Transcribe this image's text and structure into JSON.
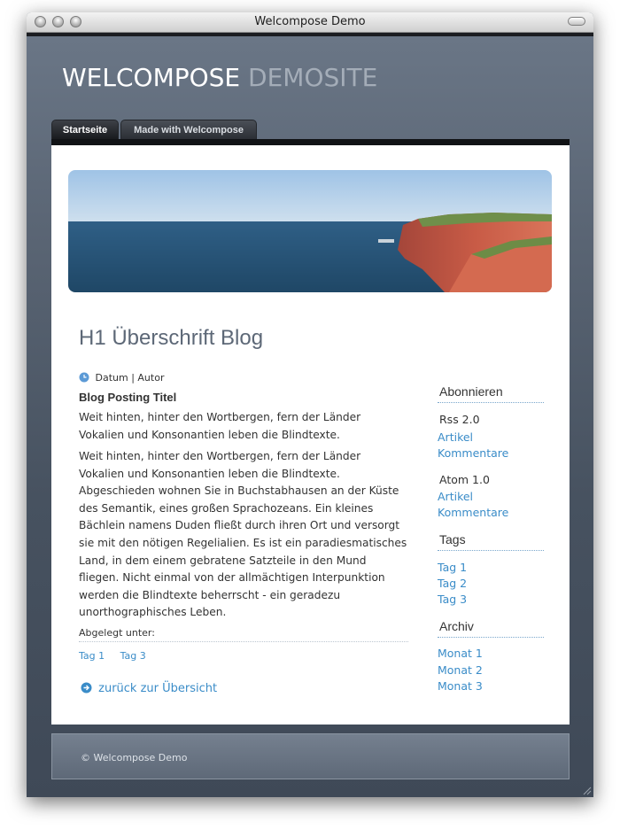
{
  "window": {
    "title": "Welcompose Demo"
  },
  "site": {
    "title_main": "WELCOMPOSE",
    "title_accent": "DEMOSITE"
  },
  "nav": {
    "tabs": [
      {
        "label": "Startseite"
      },
      {
        "label": "Made with Welcompose"
      }
    ]
  },
  "main": {
    "heading": "H1 Überschrift Blog",
    "meta": "Datum | Autor",
    "post_title": "Blog Posting Titel",
    "paragraph1": "Weit hinten, hinter den Wortbergen, fern der Länder Vokalien und Konsonantien leben die Blindtexte.",
    "paragraph2": "Weit hinten, hinter den Wortbergen, fern der Länder Vokalien und Konsonantien leben die Blindtexte. Abgeschieden wohnen Sie in Buchstabhausen an der Küste des Semantik, eines großen Sprachozeans. Ein kleines Bächlein namens Duden fließt durch ihren Ort und versorgt sie mit den nötigen Regelialien. Es ist ein paradiesmatisches Land, in dem einem gebratene Satzteile in den Mund fliegen. Nicht einmal von der allmächtigen Interpunktion werden die Blindtexte beherrscht - ein geradezu unorthographisches Leben.",
    "filed_under": "Abgelegt unter:",
    "tags": [
      "Tag 1",
      "Tag 3"
    ],
    "back_link": "zurück zur Übersicht"
  },
  "sidebar": {
    "subscribe_heading": "Abonnieren",
    "rss_label": "Rss 2.0",
    "rss_links": [
      "Artikel",
      "Kommentare"
    ],
    "atom_label": "Atom 1.0",
    "atom_links": [
      "Artikel",
      "Kommentare"
    ],
    "tags_heading": "Tags",
    "tags": [
      "Tag 1",
      "Tag 2",
      "Tag 3"
    ],
    "archive_heading": "Archiv",
    "archive": [
      "Monat 1",
      "Monat 2",
      "Monat 3"
    ]
  },
  "footer": {
    "text": "© Welcompose Demo"
  },
  "colors": {
    "link": "#3a8cc8",
    "heading": "#5d6877",
    "background": "#5f6b79"
  }
}
